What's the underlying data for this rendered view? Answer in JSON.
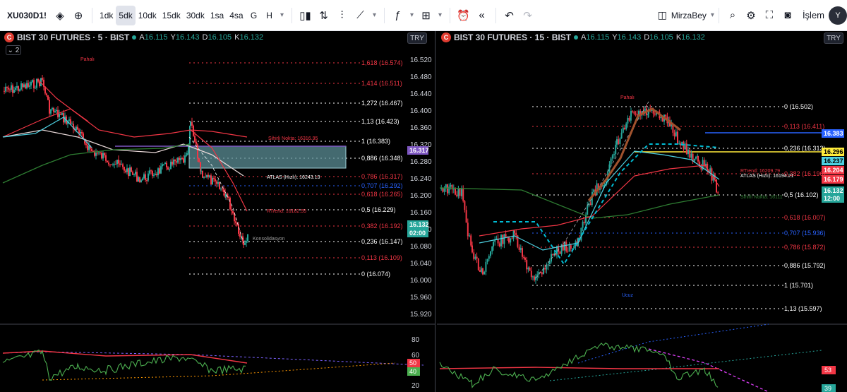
{
  "toolbar": {
    "symbol": "XU030D1!",
    "intervals": [
      "1dk",
      "5dk",
      "10dk",
      "15dk",
      "30dk",
      "1sa",
      "4sa",
      "G",
      "H"
    ],
    "active_interval": "5dk",
    "layout_name": "MirzaBey",
    "trade_label": "İşlem",
    "avatar_initials": "Y"
  },
  "left": {
    "title": "BIST 30 FUTURES · 5 · BIST",
    "ohlc": [
      {
        "k": "A",
        "v": "16.115"
      },
      {
        "k": "Y",
        "v": "16.143"
      },
      {
        "k": "D",
        "v": "16.105"
      },
      {
        "k": "K",
        "v": "16.132"
      }
    ],
    "collapse_label": "2",
    "currency": "TRY",
    "price_ticks": [
      "16.520",
      "16.480",
      "16.440",
      "16.400",
      "16.360",
      "16.320",
      "16.280",
      "16.240",
      "16.200",
      "16.160",
      "16.120",
      "16.080",
      "16.040",
      "16.000",
      "15.960",
      "15.920"
    ],
    "fib_levels": [
      {
        "label": "1,618 (16.574)",
        "color": "#f23645"
      },
      {
        "label": "1,414 (16.511)",
        "color": "#f23645"
      },
      {
        "label": "1,272 (16.467)",
        "color": "#ffffff"
      },
      {
        "label": "1,13 (16.423)",
        "color": "#ffffff"
      },
      {
        "label": "1 (16.383)",
        "color": "#ffffff"
      },
      {
        "label": "0,886 (16.348)",
        "color": "#ffffff"
      },
      {
        "label": "0,786 (16.317)",
        "color": "#f23645"
      },
      {
        "label": "0,707 (16.292)",
        "color": "#2962ff"
      },
      {
        "label": "0,618 (16.265)",
        "color": "#f23645"
      },
      {
        "label": "0,5 (16.229)",
        "color": "#ffffff"
      },
      {
        "label": "0,382 (16.192)",
        "color": "#f23645"
      },
      {
        "label": "0,236 (16.147)",
        "color": "#ffffff"
      },
      {
        "label": "0,113 (16.109)",
        "color": "#f23645"
      },
      {
        "label": "0 (16.074)",
        "color": "#ffffff"
      }
    ],
    "annotations": {
      "pahali": "Pahalı",
      "sihirli": "Sihirli Nokta: 16316.95",
      "atlas": "ATLAS (Hızlı): 16243.13",
      "rtrend": "RTrend: 16162.55",
      "konsol": "Konsolidasyon"
    },
    "price_badges": [
      {
        "text": "16.317",
        "color": "#7e57c2"
      },
      {
        "text": "16.132",
        "color": "#26a69a"
      },
      {
        "text": "02:00",
        "color": "#26a69a"
      }
    ],
    "osc_ticks": [
      "80",
      "60",
      "40",
      "20"
    ],
    "osc_badges": [
      {
        "text": "50",
        "color": "#f23645"
      },
      {
        "text": "40",
        "color": "#4caf50"
      }
    ]
  },
  "right": {
    "title": "BIST 30 FUTURES · 15 · BIST",
    "ohlc": [
      {
        "k": "A",
        "v": "16.115"
      },
      {
        "k": "Y",
        "v": "16.143"
      },
      {
        "k": "D",
        "v": "16.105"
      },
      {
        "k": "K",
        "v": "16.132"
      }
    ],
    "currency": "TRY",
    "fib_levels": [
      {
        "label": "0 (16.502)",
        "color": "#ffffff"
      },
      {
        "label": "0,113 (16.411)",
        "color": "#f23645"
      },
      {
        "label": "0,236 (16.313)",
        "color": "#ffffff"
      },
      {
        "label": "0,382 (16.196)",
        "color": "#f23645"
      },
      {
        "label": "0,5 (16.102)",
        "color": "#ffffff"
      },
      {
        "label": "0,618 (16.007)",
        "color": "#f23645"
      },
      {
        "label": "0,707 (15.936)",
        "color": "#2962ff"
      },
      {
        "label": "0,786 (15.872)",
        "color": "#f23645"
      },
      {
        "label": "0,886 (15.792)",
        "color": "#ffffff"
      },
      {
        "label": "1 (15.701)",
        "color": "#ffffff"
      },
      {
        "label": "1,13 (15.597)",
        "color": "#ffffff"
      }
    ],
    "annotations": {
      "pahali": "Pahalı",
      "ucuz": "Ucuz",
      "rtrend": "RTrend: 16209.79",
      "atlas": "ATLAS (Hızlı): 16194.21",
      "sihirli": "Sihirli Nokta: 16111"
    },
    "price_badges": [
      {
        "text": "16.383",
        "color": "#2962ff",
        "fg": "#ffffff"
      },
      {
        "text": "16.296",
        "color": "#ffeb3b",
        "fg": "#000000"
      },
      {
        "text": "16.237",
        "color": "#4dd0e1",
        "fg": "#000000"
      },
      {
        "text": "16.204",
        "color": "#f23645",
        "fg": "#ffffff"
      },
      {
        "text": "16.179",
        "color": "#f23645",
        "fg": "#ffffff"
      },
      {
        "text": "16.132",
        "color": "#26a69a",
        "fg": "#ffffff"
      },
      {
        "text": "12:00",
        "color": "#26a69a",
        "fg": "#ffffff"
      }
    ],
    "osc_badges": [
      {
        "text": "53",
        "color": "#f23645"
      },
      {
        "text": "39",
        "color": "#26a69a"
      }
    ]
  }
}
